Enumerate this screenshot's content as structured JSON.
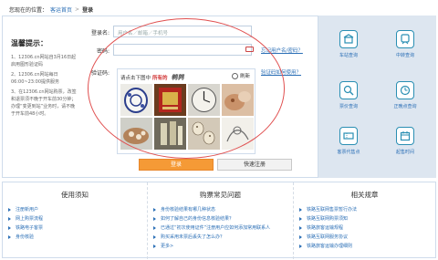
{
  "breadcrumb": {
    "prefix": "您现在的位置：",
    "home": "客运首页",
    "sep": ">",
    "current": "登录"
  },
  "tips": {
    "title": "温馨提示：",
    "items": [
      "1、12306.cn网站自3月16日起启用图形验证码",
      "2、12306.cn网站每日06:00~23:00提供服务",
      "3、在12306.cn网站购票，改签和退票须不晚于开车前30分钟；办理“变更到站”业务时，请不晚于开车前48小时。"
    ]
  },
  "form": {
    "username_label": "登录名:",
    "username_placeholder": "用户名／邮箱／手机号",
    "password_label": "密码:",
    "forgot_link": "忘记用户名/密码？",
    "captcha_label": "验证码:",
    "captcha_help_link": "验证码如何使用？",
    "login_label": "登录",
    "register_label": "快速注册"
  },
  "captcha": {
    "instruction_prefix": "请点击下图中",
    "instruction_keyword": "所有的",
    "target_word": "鹌鹑",
    "refresh_label": "刷新"
  },
  "services": [
    {
      "label": "车站查询",
      "icon": "station-icon"
    },
    {
      "label": "中转查询",
      "icon": "transfer-icon"
    },
    {
      "label": "票价查询",
      "icon": "fare-icon"
    },
    {
      "label": "正晚点查询",
      "icon": "clock-icon"
    },
    {
      "label": "客票代售点",
      "icon": "ticket-agency-icon"
    },
    {
      "label": "起售时间",
      "icon": "sale-time-icon"
    }
  ],
  "colors": {
    "accent": "#2b6fb6",
    "login_button": "#f59a36",
    "panel_bg": "#dde6f0",
    "annotation": "#e05050"
  },
  "bottom": {
    "notice": {
      "title": "使用须知",
      "items": [
        "注册新用户",
        "网上购票流程",
        "铁路电子客票",
        "身份核验"
      ]
    },
    "faq": {
      "title": "购票常见问题",
      "items": [
        "身份核验结果有哪几种状态",
        "如何了解自己的身份信息核验结果？",
        "已通过“初次使用证件”注册用户应如何添加常用联系人",
        "购买采用未票后丢失了怎么办？",
        "更多>"
      ]
    },
    "rules": {
      "title": "相关规章",
      "items": [
        "铁路互联网售票暂行办法",
        "铁路互联网购票须知",
        "铁路旅客运输规程",
        "铁路互联网服务协议",
        "铁路旅客运输办理细则"
      ]
    }
  }
}
